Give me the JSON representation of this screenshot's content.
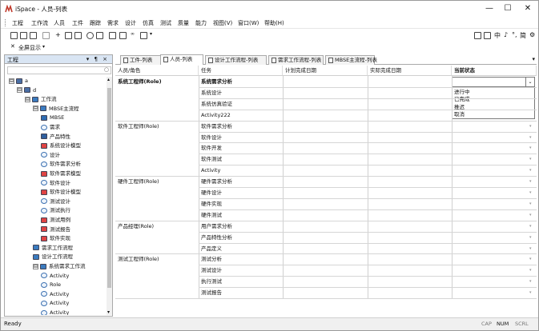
{
  "window": {
    "title": "iSpace - 人员-列表"
  },
  "menu": [
    "工程",
    "工作流",
    "人员",
    "工件",
    "跟踪",
    "需求",
    "设计",
    "仿真",
    "测试",
    "质量",
    "能力",
    "视图(V)",
    "窗口(W)",
    "帮助(H)"
  ],
  "toolbar": {
    "show_all": "全屏显示",
    "ime_chars": [
      "中",
      "简"
    ]
  },
  "panel": {
    "title": "工程",
    "controls": "▾ ¶ ×"
  },
  "tree": [
    {
      "label": "a",
      "level": 0,
      "exp": "⊟",
      "icon": "grid"
    },
    {
      "label": "d",
      "level": 1,
      "exp": "⊟",
      "icon": "folder"
    },
    {
      "label": "工作流",
      "level": 2,
      "exp": "⊟",
      "icon": "flow"
    },
    {
      "label": "MBSE主流程",
      "level": 3,
      "exp": "⊟",
      "icon": "flow"
    },
    {
      "label": "MBSE",
      "level": 4,
      "exp": "",
      "icon": "table"
    },
    {
      "label": "需求",
      "level": 4,
      "exp": "",
      "icon": "ellipse"
    },
    {
      "label": "产品特性",
      "level": 4,
      "exp": "",
      "icon": "doc"
    },
    {
      "label": "系统设计模型",
      "level": 4,
      "exp": "",
      "icon": "red"
    },
    {
      "label": "设计",
      "level": 4,
      "exp": "",
      "icon": "ellipse"
    },
    {
      "label": "软件需求分析",
      "level": 4,
      "exp": "",
      "icon": "ellipse"
    },
    {
      "label": "软件需求模型",
      "level": 4,
      "exp": "",
      "icon": "red"
    },
    {
      "label": "软件设计",
      "level": 4,
      "exp": "",
      "icon": "ellipse"
    },
    {
      "label": "软件设计模型",
      "level": 4,
      "exp": "",
      "icon": "red"
    },
    {
      "label": "测试设计",
      "level": 4,
      "exp": "",
      "icon": "ellipse"
    },
    {
      "label": "测试执行",
      "level": 4,
      "exp": "",
      "icon": "ellipse"
    },
    {
      "label": "测试用例",
      "level": 4,
      "exp": "",
      "icon": "red"
    },
    {
      "label": "测试报告",
      "level": 4,
      "exp": "",
      "icon": "red"
    },
    {
      "label": "软件实现",
      "level": 4,
      "exp": "",
      "icon": "red"
    },
    {
      "label": "需求工作流程",
      "level": 3,
      "exp": "",
      "icon": "flow"
    },
    {
      "label": "设计工作流程",
      "level": 3,
      "exp": "",
      "icon": "flow"
    },
    {
      "label": "系统需求工作流",
      "level": 3,
      "exp": "⊟",
      "icon": "flow"
    },
    {
      "label": "Activity",
      "level": 4,
      "exp": "",
      "icon": "ellipse"
    },
    {
      "label": "Role",
      "level": 4,
      "exp": "",
      "icon": "role"
    },
    {
      "label": "Activity",
      "level": 4,
      "exp": "",
      "icon": "ellipse"
    },
    {
      "label": "Activity",
      "level": 4,
      "exp": "",
      "icon": "ellipse"
    },
    {
      "label": "Activity",
      "level": 4,
      "exp": "",
      "icon": "ellipse"
    }
  ],
  "tabs": [
    "工件-列表",
    "人员-列表",
    "设计工作流程-列表",
    "需求工作流程-列表",
    "MBSE主流程-列表"
  ],
  "active_tab": 1,
  "grid": {
    "headers": [
      "人员/角色",
      "任务",
      "计划完成日期",
      "实际完成日期",
      "当前状态"
    ],
    "rows": [
      {
        "role": "系统工程师(Role)",
        "task": "系统需求分析",
        "bold": true
      },
      {
        "role": "",
        "task": "系统设计"
      },
      {
        "role": "",
        "task": "系统仿真验证"
      },
      {
        "role": "",
        "task": "Activity222"
      },
      {
        "role": "软件工程师(Role)",
        "task": "软件需求分析"
      },
      {
        "role": "",
        "task": "软件设计"
      },
      {
        "role": "",
        "task": "软件开发"
      },
      {
        "role": "",
        "task": "软件测试"
      },
      {
        "role": "",
        "task": "Activity"
      },
      {
        "role": "硬件工程师(Role)",
        "task": "硬件需求分析"
      },
      {
        "role": "",
        "task": "硬件设计"
      },
      {
        "role": "",
        "task": "硬件实现"
      },
      {
        "role": "",
        "task": "硬件测试"
      },
      {
        "role": "产品经理(Role)",
        "task": "用户需求分析"
      },
      {
        "role": "",
        "task": "产品特性分析"
      },
      {
        "role": "",
        "task": "产品定义"
      },
      {
        "role": "测试工程师(Role)",
        "task": "测试分析"
      },
      {
        "role": "",
        "task": "测试设计"
      },
      {
        "role": "",
        "task": "执行测试"
      },
      {
        "role": "",
        "task": "测试报告"
      }
    ],
    "status_options": [
      "进行中",
      "已完成",
      "推迟",
      "取消"
    ]
  },
  "status_bar": {
    "ready": "Ready",
    "cap": "CAP",
    "num": "NUM",
    "scrl": "SCRL"
  }
}
